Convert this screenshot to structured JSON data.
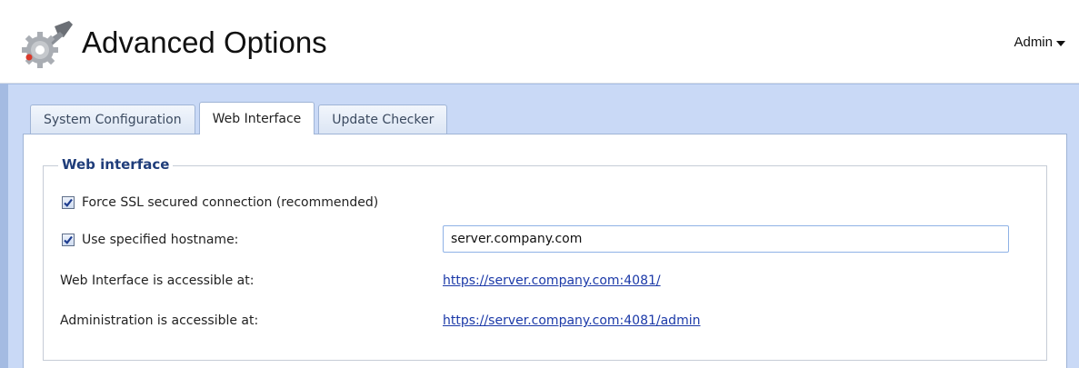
{
  "header": {
    "title": "Advanced Options",
    "user_menu_label": "Admin",
    "app_icon": "gear-wrench-icon"
  },
  "tabs": [
    {
      "label": "System Configuration",
      "active": false
    },
    {
      "label": "Web Interface",
      "active": true
    },
    {
      "label": "Update Checker",
      "active": false
    }
  ],
  "web_interface": {
    "legend": "Web interface",
    "force_ssl": {
      "label": "Force SSL secured connection (recommended)",
      "checked": true
    },
    "use_hostname": {
      "label": "Use specified hostname:",
      "checked": true
    },
    "hostname_value": "server.company.com",
    "web_access_label": "Web Interface is accessible at:",
    "web_access_url": "https://server.company.com:4081/",
    "admin_access_label": "Administration is accessible at:",
    "admin_access_url": "https://server.company.com:4081/admin"
  },
  "colors": {
    "accent_link": "#1b39a8",
    "legend_text": "#1f3d7a",
    "content_background": "#c9d9f6"
  }
}
